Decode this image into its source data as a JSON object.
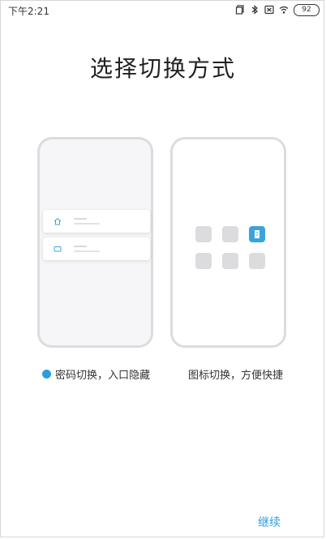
{
  "status_bar": {
    "time": "下午2:21",
    "battery": "92",
    "icons": [
      "copy-icon",
      "bluetooth-icon",
      "silent-icon",
      "wifi-icon",
      "battery-icon"
    ]
  },
  "title": "选择切换方式",
  "options": [
    {
      "id": "password",
      "label": "密码切换，入口隐藏",
      "selected": true
    },
    {
      "id": "icon",
      "label": "图标切换，方便快捷",
      "selected": false
    }
  ],
  "continue_label": "继续",
  "colors": {
    "accent": "#2a9fe0",
    "tile_active": "#3ba3dc",
    "tile": "#dcdcde",
    "frame": "#dcdcde"
  }
}
